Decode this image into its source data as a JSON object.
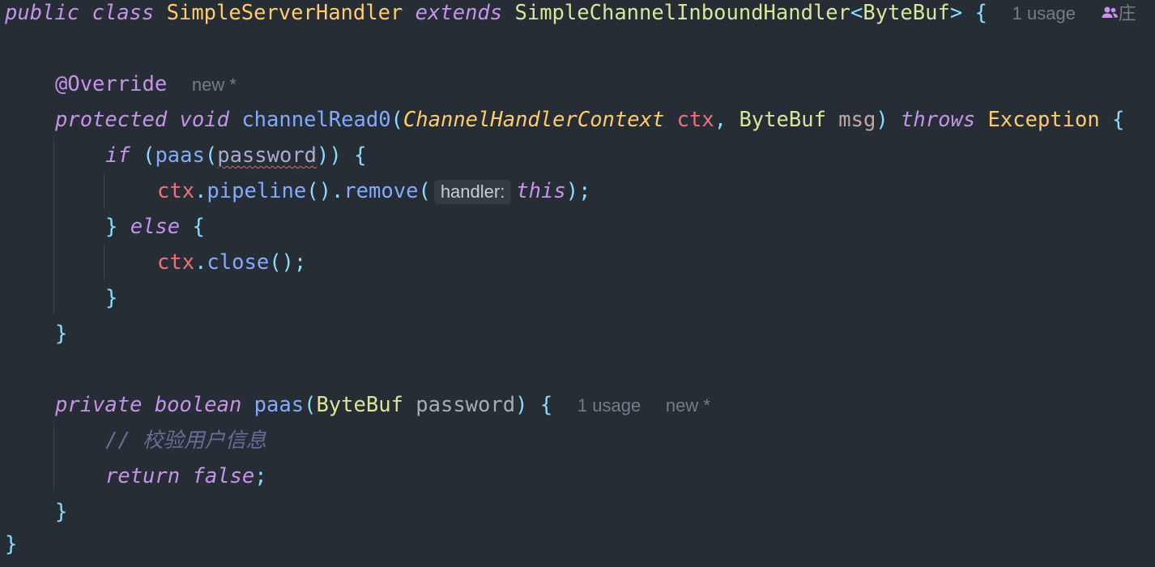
{
  "code": {
    "class_decl": {
      "public": "public",
      "class": "class",
      "class_name": "SimpleServerHandler",
      "extends": "extends",
      "super_class": "SimpleChannelInboundHandler",
      "lt": "<",
      "generic_type": "ByteBuf",
      "gt": ">",
      "brace": "{",
      "usage_hint": "1 usage",
      "author_hint": "庄"
    },
    "override_line": {
      "annotation": "@Override",
      "hint": "new *"
    },
    "method1": {
      "protected": "protected",
      "void": "void",
      "name": "channelRead0",
      "open_paren": "(",
      "param1_type": "ChannelHandlerContext",
      "param1_name": "ctx",
      "comma": ",",
      "param2_type": "ByteBuf",
      "param2_name": "msg",
      "close_paren": ")",
      "throws": "throws",
      "exception": "Exception",
      "brace": "{"
    },
    "if_line": {
      "if": "if",
      "open": "(",
      "call": "paas",
      "call_open": "(",
      "arg": "password",
      "close": "))",
      "brace": "{"
    },
    "remove_line": {
      "ctx": "ctx",
      "dot1": ".",
      "pipeline": "pipeline",
      "parens": "()",
      "dot2": ".",
      "remove": "remove",
      "open": "(",
      "inlay_hint": "handler:",
      "this": "this",
      "close": ")",
      "semi": ";"
    },
    "else_line": {
      "close_brace": "}",
      "else": "else",
      "brace": "{"
    },
    "close_line": {
      "ctx": "ctx",
      "dot": ".",
      "close": "close",
      "parens": "()",
      "semi": ";"
    },
    "if_end": "}",
    "method1_end": "}",
    "method2": {
      "private": "private",
      "boolean": "boolean",
      "name": "paas",
      "open": "(",
      "param_type": "ByteBuf",
      "param_name": "password",
      "close": ")",
      "brace": "{",
      "usage_hint": "1 usage",
      "new_hint": "new *"
    },
    "comment": "// 校验用户信息",
    "return_line": {
      "return": "return",
      "false": "false",
      "semi": ";"
    },
    "method2_end": "}",
    "class_end": "}"
  }
}
